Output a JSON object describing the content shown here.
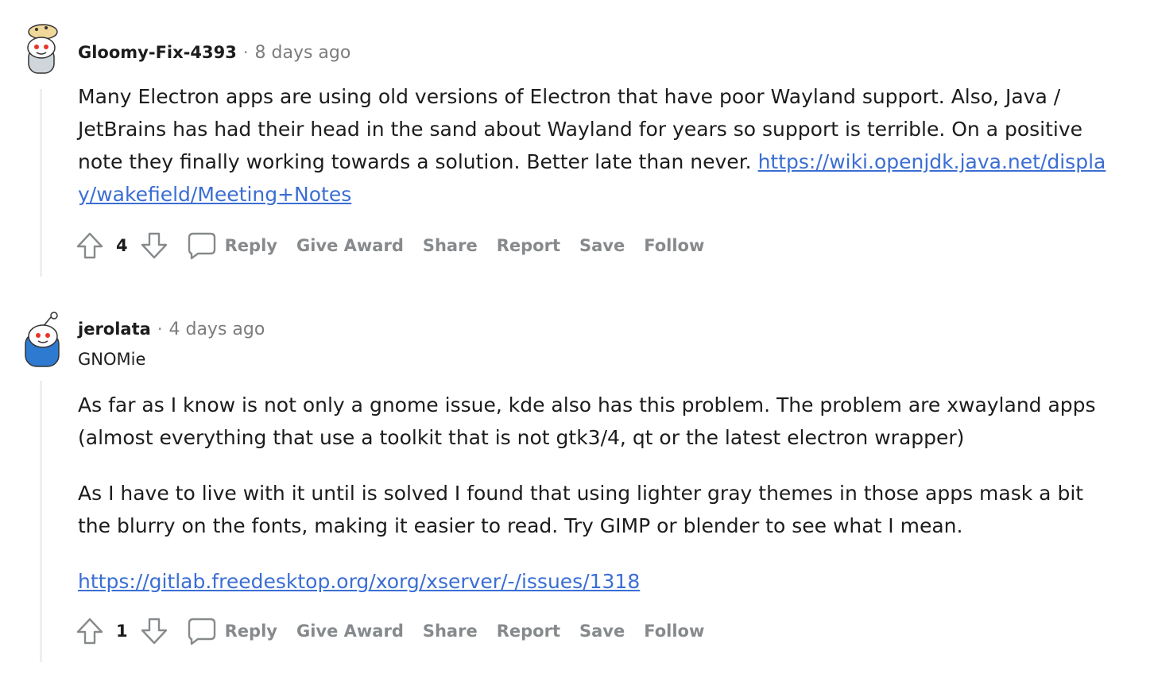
{
  "comments": [
    {
      "author": "Gloomy-Fix-4393",
      "time": "8 days ago",
      "paragraphs": [
        {
          "text": "Many Electron apps are using old versions of Electron that have poor Wayland support. Also, Java / JetBrains has had their head in the sand about Wayland for years so support is terrible. On a positive note they finally working towards a solution. Better late than never. ",
          "link": "https://wiki.openjdk.java.net/display/wakefield/Meeting+Notes"
        }
      ],
      "score": "4",
      "actions": {
        "reply": "Reply",
        "award": "Give Award",
        "share": "Share",
        "report": "Report",
        "save": "Save",
        "follow": "Follow"
      }
    },
    {
      "author": "jerolata",
      "time": "4 days ago",
      "flair": "GNOMie",
      "paragraphs": [
        {
          "text": "As far as I know is not only a gnome issue, kde also has this problem. The problem are xwayland apps (almost everything that use a toolkit that is not gtk3/4, qt or the latest electron wrapper)"
        },
        {
          "text": "As I have to live with it until is solved I found that using lighter gray themes in those apps mask a bit the blurry on the fonts, making it easier to read. Try GIMP or blender to see what I mean."
        },
        {
          "link": "https://gitlab.freedesktop.org/xorg/xserver/-/issues/1318"
        }
      ],
      "score": "1",
      "actions": {
        "reply": "Reply",
        "award": "Give Award",
        "share": "Share",
        "report": "Report",
        "save": "Save",
        "follow": "Follow"
      }
    }
  ],
  "separator": "·",
  "colors": {
    "link": "#3b6ed4",
    "muted": "#878a8c",
    "thread": "#edeff1"
  }
}
